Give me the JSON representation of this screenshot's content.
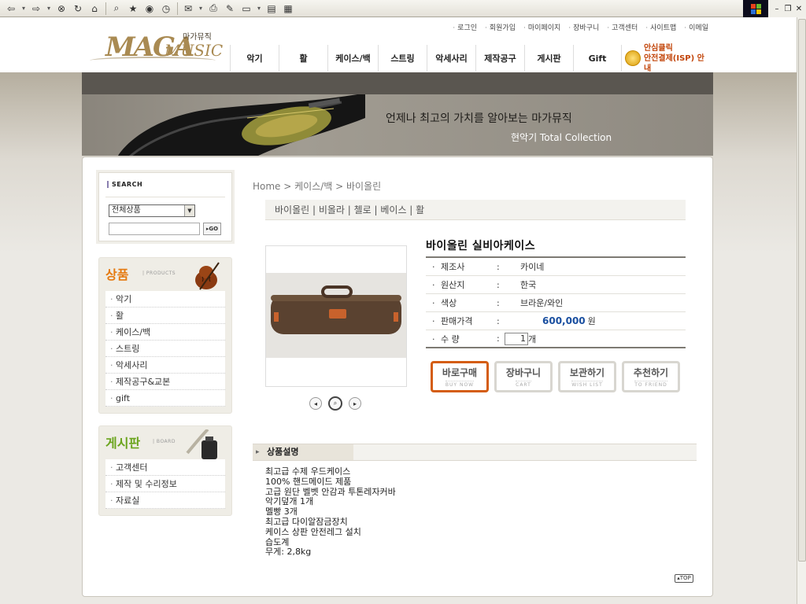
{
  "top_links": [
    "로그인",
    "회원가입",
    "마이페이지",
    "장바구니",
    "고객센터",
    "사이트맵",
    "이메일"
  ],
  "logo": {
    "maga": "MAGA",
    "music": "MUSIC",
    "korean": "마가뮤직"
  },
  "gnb": [
    "악기",
    "활",
    "케이스/백",
    "스트링",
    "악세사리",
    "제작공구",
    "게시판",
    "Gift"
  ],
  "safe_payment": {
    "line1": "안심클릭",
    "line2": "안전결제(ISP) 안내"
  },
  "banner": {
    "line1": "언제나  최고의 가치를 알아보는 마가뮤직",
    "line2": "현악기 Total Collection"
  },
  "search": {
    "title": "SEARCH",
    "select_value": "전체상품",
    "go_label": "▸GO"
  },
  "products_box": {
    "title": "상품",
    "subtitle": "| PRODUCTS",
    "items": [
      "악기",
      "활",
      "케이스/백",
      "스트링",
      "악세사리",
      "제작공구&교본",
      "gift"
    ]
  },
  "board_box": {
    "title": "게시판",
    "subtitle": "| BOARD",
    "items": [
      "고객센터",
      "제작 및 수리정보",
      "자료실"
    ]
  },
  "breadcrumb": "Home > 케이스/백 > 바이올린",
  "subnav": "바이올린 | 비올라 | 첼로 | 베이스 | 활",
  "product": {
    "title": "바이올린 실비아케이스",
    "specs": [
      {
        "label": "제조사",
        "value": "카이네"
      },
      {
        "label": "원산지",
        "value": "한국"
      },
      {
        "label": "색상",
        "value": "브라운/와인"
      }
    ],
    "price_label": "판매가격",
    "price": "600,000",
    "currency": "원",
    "qty_label": "수 량",
    "qty_value": "1",
    "qty_unit": "개"
  },
  "buttons": [
    {
      "kr": "바로구매",
      "en": "BUY NOW"
    },
    {
      "kr": "장바구니",
      "en": "CART"
    },
    {
      "kr": "보관하기",
      "en": "WISH LIST"
    },
    {
      "kr": "추천하기",
      "en": "TO FRIEND"
    }
  ],
  "description": {
    "heading": "상품설명",
    "lines": [
      "최고급 수제 우드케이스",
      "100% 핸드메이드 제품",
      "고급 원단 벨벳 안감과  투톤레자커바",
      "악기덮개 1개",
      "멜빵 3개",
      "최고급 다이알잠금장치",
      "케이스 상판 안전레그 설치",
      "습도계",
      "무게: 2,8kg"
    ]
  },
  "top_label": "TOP",
  "colors": {
    "accent_orange": "#e57a10",
    "price_blue": "#1a4fa0",
    "board_green": "#6aa41c",
    "buy_border": "#d45d12"
  }
}
